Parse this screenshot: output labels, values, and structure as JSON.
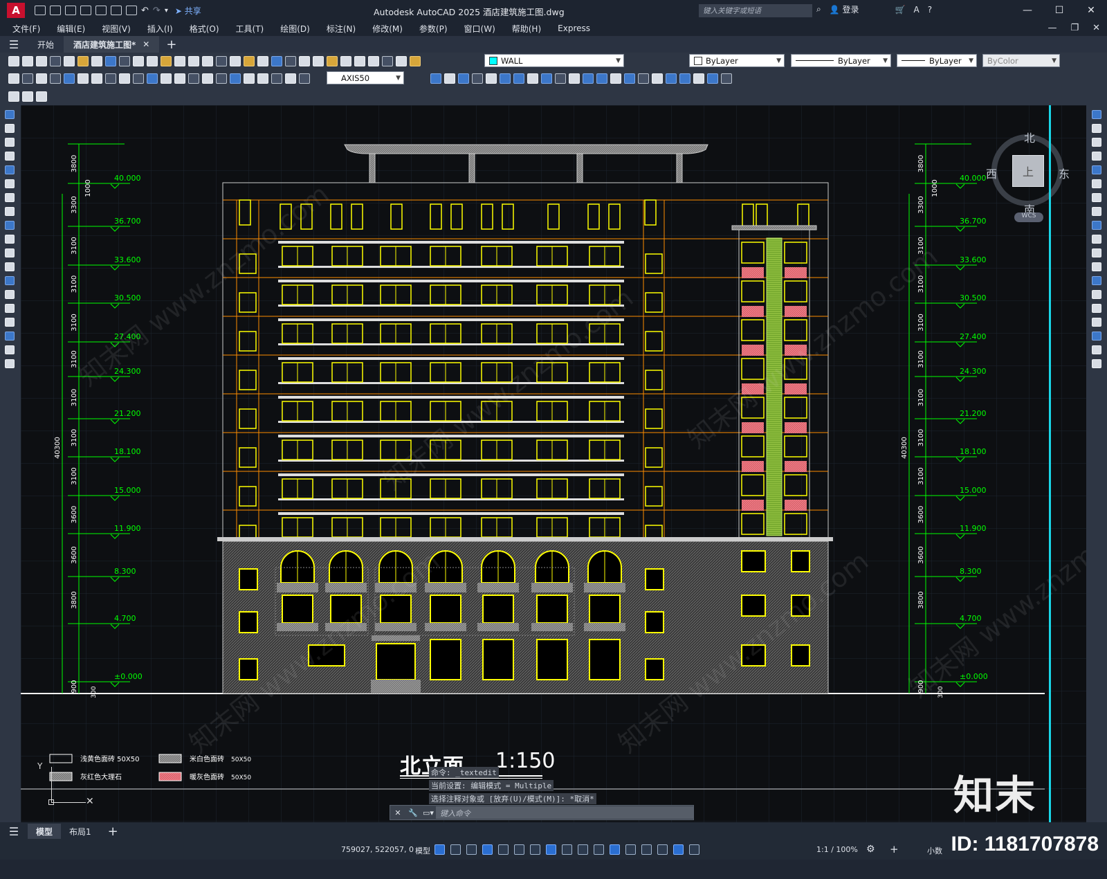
{
  "titlebar": {
    "app_logo": "A",
    "share_label": "共享",
    "title": "Autodesk AutoCAD 2025    酒店建筑施工图.dwg",
    "search_placeholder": "键入关键字或短语",
    "login_label": "登录"
  },
  "menu": [
    "文件(F)",
    "编辑(E)",
    "视图(V)",
    "插入(I)",
    "格式(O)",
    "工具(T)",
    "绘图(D)",
    "标注(N)",
    "修改(M)",
    "参数(P)",
    "窗口(W)",
    "帮助(H)",
    "Express"
  ],
  "tabs": {
    "start": "开始",
    "active": "酒店建筑施工图*"
  },
  "toolbar": {
    "layer_name": "WALL",
    "layer_color": "#00ffff",
    "color_value": "ByLayer",
    "linetype_value": "ByLayer",
    "lineweight_value": "ByLayer",
    "plotstyle_value": "ByColor",
    "dimstyle_value": "AXIS50"
  },
  "viewcube": {
    "north": "北",
    "south": "南",
    "east": "东",
    "west": "西",
    "top": "上",
    "wcs": "WCS"
  },
  "drawing": {
    "title": "北立面",
    "scale": "1:150",
    "elevations": [
      "40.000",
      "36.700",
      "33.600",
      "30.500",
      "27.400",
      "24.300",
      "21.200",
      "18.100",
      "15.000",
      "11.900",
      "8.300",
      "4.700",
      "±0.000"
    ],
    "segment_dims": [
      "3800",
      "3300",
      "3100",
      "3100",
      "3100",
      "3100",
      "3100",
      "3100",
      "3100",
      "3600",
      "3600",
      "3800"
    ],
    "top_small_dim": "1000",
    "bottom_dim": "900",
    "bottom_small_dim": "300",
    "total_height": "40300",
    "legend": [
      {
        "label": "浅黄色面砖 50X50",
        "fill": "none"
      },
      {
        "label": "米白色面砖",
        "size": "50X50",
        "fill": "hatch"
      },
      {
        "label": "灰红色大理石",
        "fill": "hatch"
      },
      {
        "label": "暖灰色面砖",
        "size": "50X50",
        "fill": "#e06a73"
      }
    ]
  },
  "command": {
    "history": [
      "命令: _textedit",
      "当前设置: 编辑模式 = Multiple",
      "选择注释对象或 [放弃(U)/模式(M)]: *取消*"
    ],
    "placeholder": "键入命令"
  },
  "layout_tabs": [
    "模型",
    "布局1"
  ],
  "status": {
    "coords": "759027, 522057, 0",
    "model": "模型",
    "scale": "1:1 / 100%",
    "units": "小数"
  },
  "watermark": {
    "logo": "知末",
    "id": "ID: 1181707878",
    "site": "www.znzmo.com",
    "cn": "知末网"
  }
}
